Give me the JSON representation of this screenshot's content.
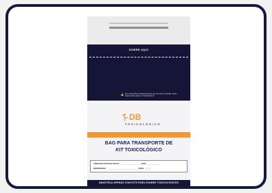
{
  "bag": {
    "fold_label": "DOBRE AQUI",
    "warning_text": "EM CONDIÇÕES PERMANENTES DE USO NÃO CONTÉM ITENS PERIGOSOS PARA O TRANSPORTE",
    "logo": {
      "brand": "DB",
      "subtitle": "TOXICOLÓGICO"
    },
    "title_line1": "BAG PARA TRANSPORTE DE",
    "title_kit": "KIT",
    "title_rest": " TOXICOLÓGICO",
    "form": {
      "line1": "CÓDIGO DO POSTO DE COLETA: _______________________  DATA: _______________",
      "line2": "RESPONSÁVEL: __________________________________  ASSIN.: __/__/__"
    },
    "footer": "ABASTEÇA APENAS COM KITS PARA EXAMES TOXICOLÓGICOS"
  },
  "colors": {
    "navy": "#151538",
    "orange": "#f19a35",
    "frame": "#141a3a"
  }
}
